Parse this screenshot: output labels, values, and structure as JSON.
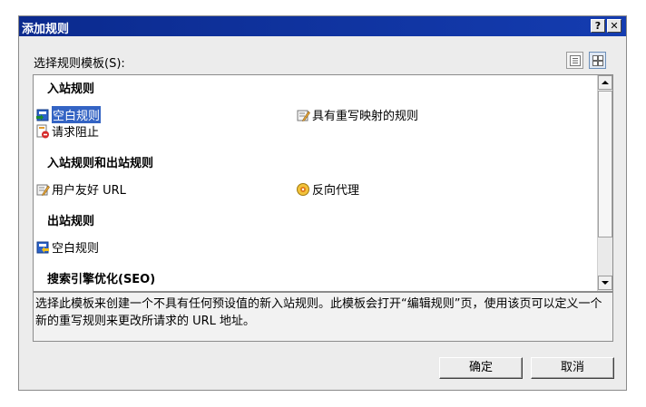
{
  "window": {
    "title": "添加规则",
    "help_label": "?",
    "close_label": "✕"
  },
  "template_label": "选择规则模板(S):",
  "groups": {
    "inbound": {
      "heading": "入站规则",
      "items": [
        {
          "label": "空白规则",
          "icon": "blank-rule-icon"
        },
        {
          "label": "具有重写映射的规则",
          "icon": "rewrite-map-icon"
        },
        {
          "label": "请求阻止",
          "icon": "request-block-icon"
        }
      ]
    },
    "inout": {
      "heading": "入站规则和出站规则",
      "items": [
        {
          "label": "用户友好 URL",
          "icon": "friendly-url-icon"
        },
        {
          "label": "反向代理",
          "icon": "reverse-proxy-icon"
        }
      ]
    },
    "outbound": {
      "heading": "出站规则",
      "items": [
        {
          "label": "空白规则",
          "icon": "outbound-blank-icon"
        }
      ]
    },
    "seo": {
      "heading": "搜索引擎优化(SEO)"
    }
  },
  "description": "选择此模板来创建一个不具有任何预设值的新入站规则。此模板会打开“编辑规则”页，使用该页可以定义一个新的重写规则来更改所请求的 URL 地址。",
  "buttons": {
    "ok": "确定",
    "cancel": "取消"
  },
  "colors": {
    "titlebar": "#0b2a8e",
    "selection": "#3464c4"
  }
}
